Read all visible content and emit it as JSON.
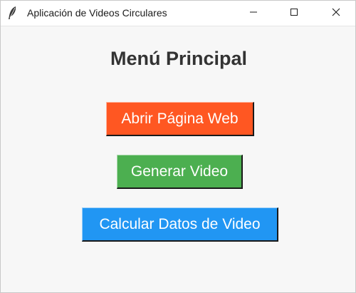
{
  "window": {
    "title": "Aplicación de Videos Circulares",
    "icon": "feather-icon"
  },
  "controls": {
    "minimize_icon": "minimize-icon",
    "maximize_icon": "maximize-icon",
    "close_icon": "close-icon"
  },
  "main": {
    "title": "Menú Principal",
    "buttons": [
      {
        "label": "Abrir Página Web",
        "color": "#ff5722"
      },
      {
        "label": "Generar Video",
        "color": "#4caf50"
      },
      {
        "label": "Calcular Datos de Video",
        "color": "#2196f3"
      }
    ]
  }
}
